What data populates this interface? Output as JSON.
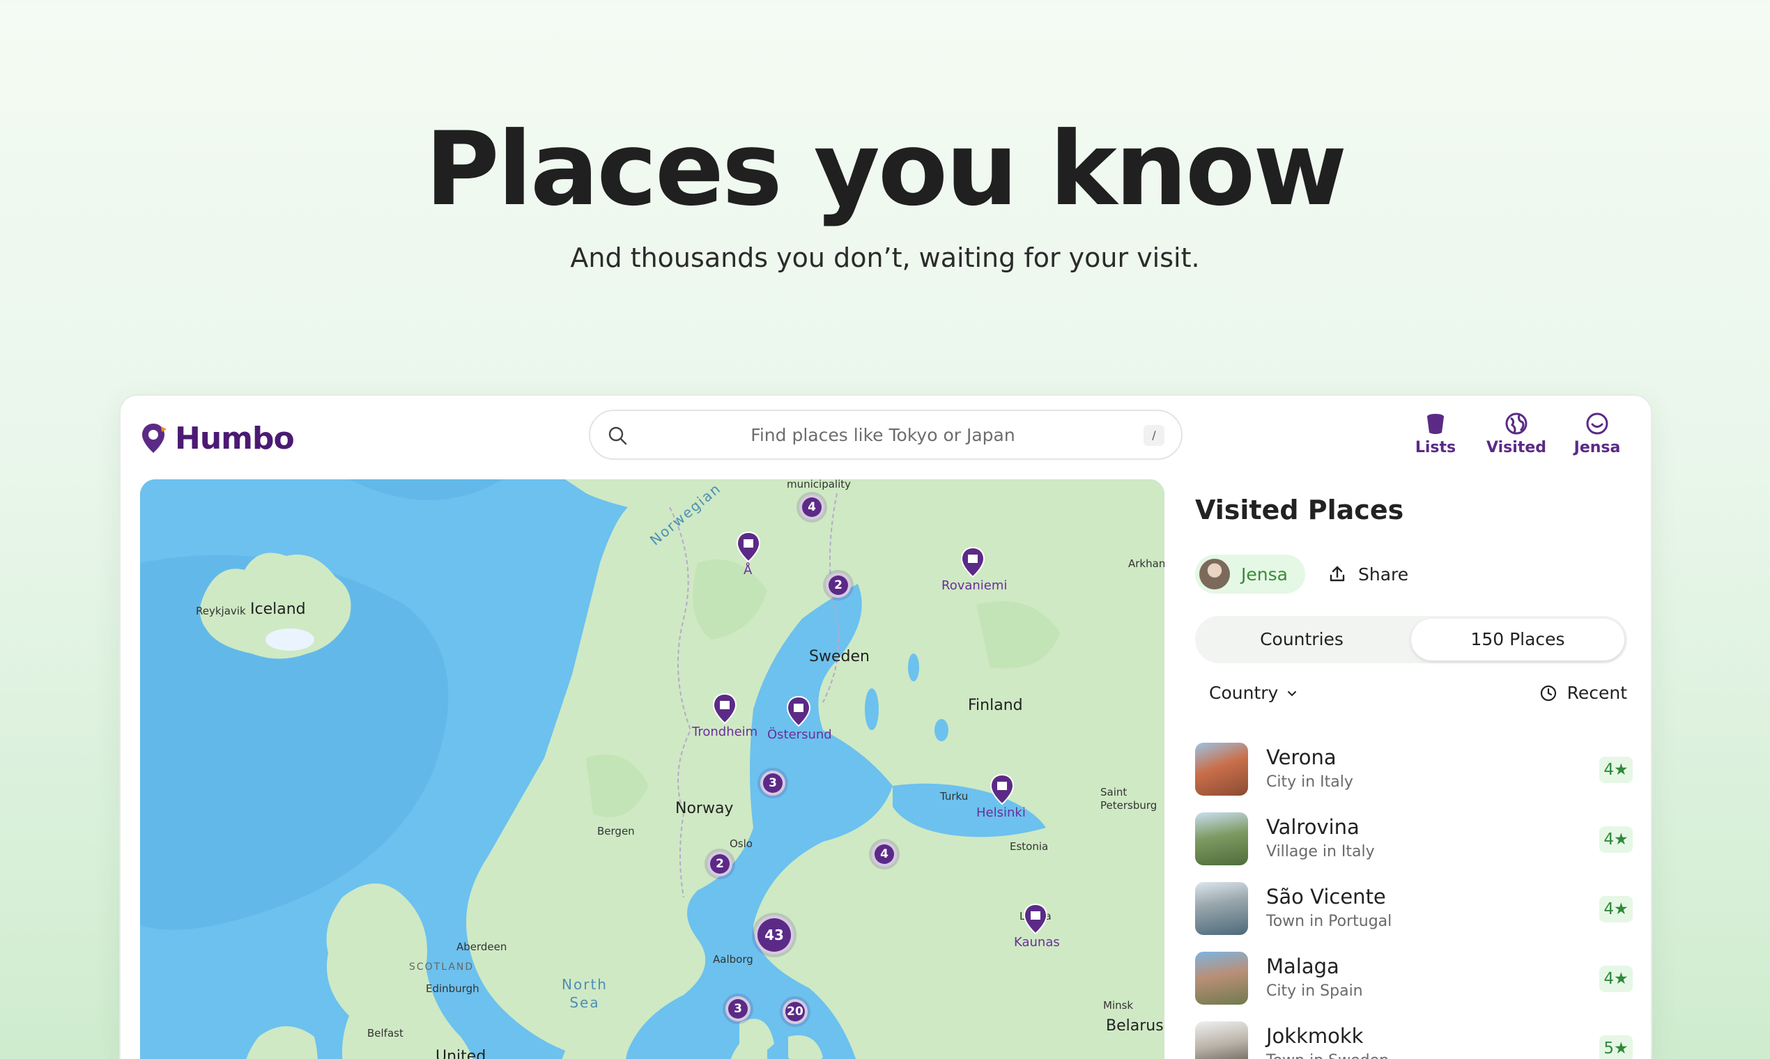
{
  "hero": {
    "title": "Places you know",
    "subtitle": "And thousands you don’t, waiting for your visit."
  },
  "header": {
    "logo": "Humbo",
    "search_placeholder": "Find places like Tokyo or Japan",
    "search_shortcut": "/",
    "nav": [
      {
        "label": "Lists",
        "icon": "bucket-icon"
      },
      {
        "label": "Visited",
        "icon": "globe-icon"
      },
      {
        "label": "Jensa",
        "icon": "smiley-icon"
      }
    ]
  },
  "map": {
    "labels": {
      "iceland": "Iceland",
      "reykjavik": "Reykjavik",
      "norwegian": "Norwegian",
      "municipality": "municipality",
      "sweden": "Sweden",
      "finland": "Finland",
      "norway": "Norway",
      "bergen": "Bergen",
      "oslo": "Oslo",
      "turku": "Turku",
      "saint_petersburg": "Saint Petersburg",
      "estonia": "Estonia",
      "latvia": "Latvia",
      "aberdeen": "Aberdeen",
      "scotland": "SCOTLAND",
      "edinburgh": "Edinburgh",
      "north_sea": "North Sea",
      "aalborg": "Aalborg",
      "belfast": "Belfast",
      "united": "United",
      "minsk": "Minsk",
      "belarus": "Belarus",
      "arkhan": "Arkhan"
    },
    "pins": {
      "a": "Å",
      "rovaniemi": "Rovaniemi",
      "trondheim": "Trondheim",
      "ostersund": "Östersund",
      "helsinki": "Helsinki",
      "kaunas": "Kaunas"
    },
    "clusters": {
      "c1": "4",
      "c2": "2",
      "c3": "3",
      "c4": "4",
      "c5": "2",
      "c6": "43",
      "c7": "3",
      "c8": "20"
    }
  },
  "panel": {
    "title": "Visited Places",
    "user": "Jensa",
    "share": "Share",
    "tabs": {
      "countries": "Countries",
      "places": "150 Places"
    },
    "filter_country": "Country",
    "sort": "Recent",
    "places": [
      {
        "name": "Verona",
        "sub": "City in Italy",
        "rating": "4★"
      },
      {
        "name": "Valrovina",
        "sub": "Village in Italy",
        "rating": "4★"
      },
      {
        "name": "São Vicente",
        "sub": "Town in Portugal",
        "rating": "4★"
      },
      {
        "name": "Malaga",
        "sub": "City in Spain",
        "rating": "4★"
      },
      {
        "name": "Jokkmokk",
        "sub": "Town in Sweden",
        "rating": "5★"
      }
    ]
  },
  "colors": {
    "brand": "#5b2a86",
    "accent_green": "#3a8b3a",
    "water": "#6cc1ee",
    "land": "#cfe9c4"
  }
}
